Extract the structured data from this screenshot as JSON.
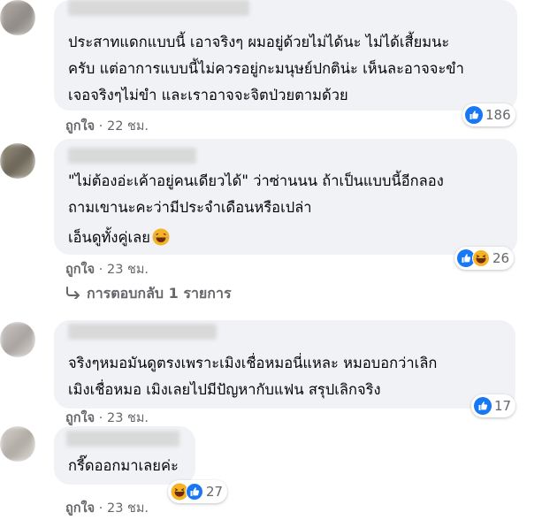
{
  "colors": {
    "bubble": "#f0f2f5",
    "secondary_text": "#65676b",
    "like_blue": "#1877f2",
    "haha_yellow": "#f7b125"
  },
  "comments": [
    {
      "author": "",
      "lines": [
        "ประสาทแดกแบบนี้ เอาจริงๆ ผมอยู่ด้วยไม่ได้นะ ไม่ได้เสี้ยมนะ",
        "ครับ แต่อาการแบบนี้ไม่ควรอยู่กะมนุษย์ปกติน่ะ เห็นละอาจจะขำ",
        "เจอจริงๆไม่ขำ และเราอาจจะจิตป่วยตามด้วย"
      ],
      "action_like": "ถูกใจ",
      "dot": "·",
      "time": "22 ชม.",
      "reactions": [
        "like-icon"
      ],
      "reaction_count": "186"
    },
    {
      "author": "",
      "lines": [
        "\"ไม่ต้องอ่ะเค้าอยู่คนเดียวได้\" ว่าซ่านนน ถ้าเป็นแบบนี้อีกลอง",
        "ถามเขานะคะว่ามีประจำเดือนหรือเปล่า",
        "เอ็นดูทั้งคู่เลย"
      ],
      "action_like": "ถูกใจ",
      "dot": "·",
      "time": "23 ชม.",
      "reactions": [
        "like-icon",
        "haha-icon"
      ],
      "reaction_count": "26",
      "replies": "การตอบกลับ 1 รายการ"
    },
    {
      "author": "",
      "lines": [
        "จริงๆหมอมันดูตรงเพราะเมิงเชื่อหมอนี่แหละ หมอบอกว่าเลิก",
        "เมิงเชื่อหมอ เมิงเลยไปมีปัญหากับแฟน สรุปเลิกจริง"
      ],
      "action_like": "ถูกใจ",
      "dot": "·",
      "time": "23 ชม.",
      "reactions": [
        "like-icon"
      ],
      "reaction_count": "17"
    },
    {
      "author": "",
      "lines": [
        "กรี๊ดออกมาเลยค่ะ"
      ],
      "action_like": "ถูกใจ",
      "dot": "·",
      "time": "23 ชม.",
      "reactions": [
        "haha-icon",
        "like-icon"
      ],
      "reaction_count": "27"
    }
  ]
}
